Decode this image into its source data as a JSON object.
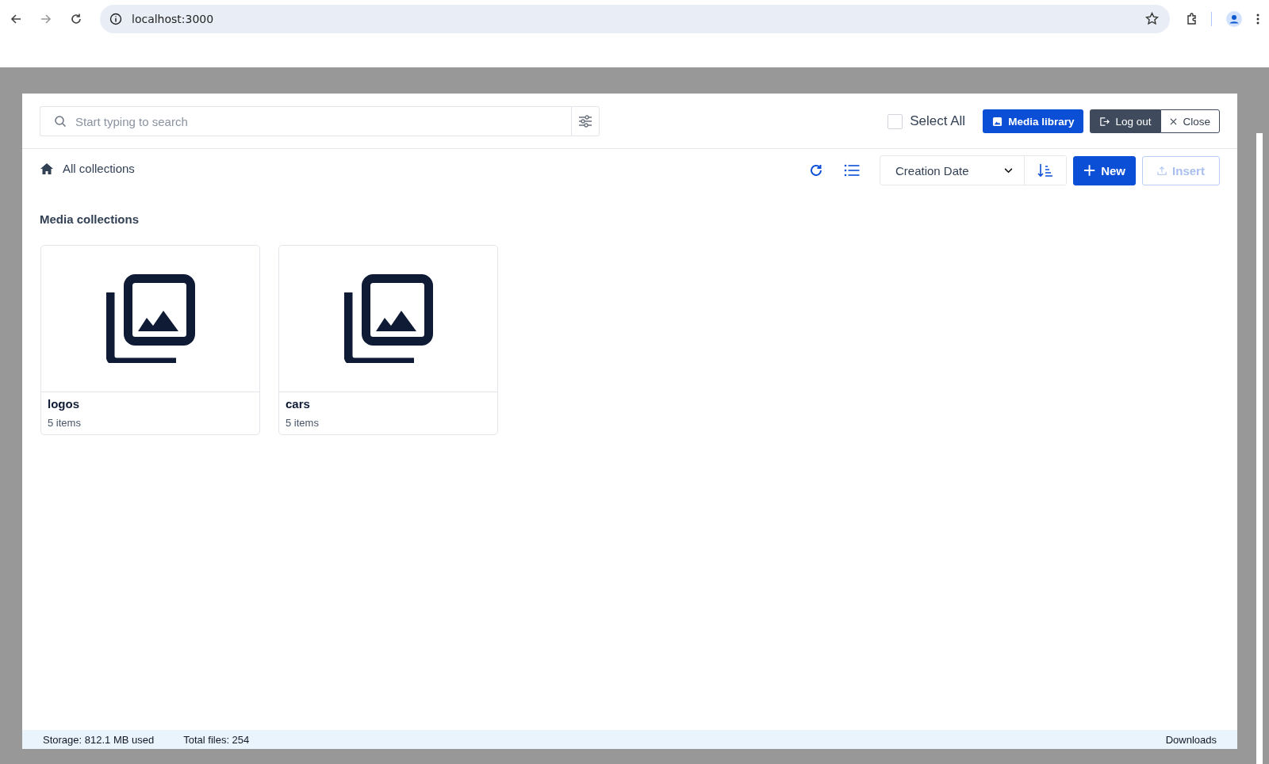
{
  "browser": {
    "url": "localhost:3000"
  },
  "toolbar": {
    "search": {
      "placeholder": "Start typing to search"
    },
    "select_all": {
      "label": "Select All",
      "checked": false
    },
    "buttons": [
      {
        "label": "Media library",
        "kind": "primary"
      },
      {
        "label": "Log out",
        "kind": "dark"
      },
      {
        "label": "Close",
        "kind": "outline"
      }
    ]
  },
  "breadcrumb": {
    "label": "All collections"
  },
  "sort": {
    "value": "Creation Date"
  },
  "actions": [
    {
      "label": "New",
      "kind": "new",
      "disabled": false
    },
    {
      "label": "Insert",
      "kind": "insert",
      "disabled": true
    }
  ],
  "section_title": "Media collections",
  "collections": [
    {
      "name": "logos",
      "count": "5 items"
    },
    {
      "name": "cars",
      "count": "5 items"
    }
  ],
  "status_bar": {
    "storage": "Storage: 812.1 MB used",
    "total": "Total files: 254",
    "downloads": "Downloads"
  }
}
